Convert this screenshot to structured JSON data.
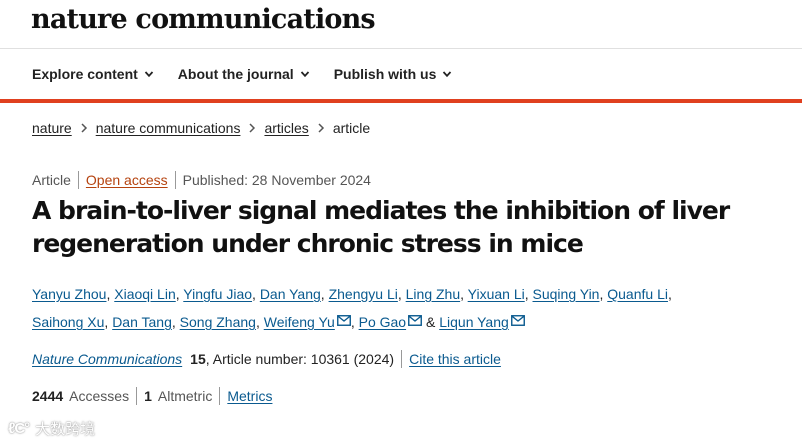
{
  "masthead": {
    "logo": "nature communications"
  },
  "nav": {
    "items": [
      {
        "label": "Explore content"
      },
      {
        "label": "About the journal"
      },
      {
        "label": "Publish with us"
      }
    ]
  },
  "breadcrumb": {
    "items": [
      "nature",
      "nature communications",
      "articles"
    ],
    "current": "article"
  },
  "meta": {
    "type": "Article",
    "access": "Open access",
    "published": "Published: 28 November 2024"
  },
  "article": {
    "title": "A brain-to-liver signal mediates the inhibition of liver regeneration under chronic stress in mice",
    "authors": [
      "Yanyu Zhou",
      "Xiaoqi Lin",
      "Yingfu Jiao",
      "Dan Yang",
      "Zhengyu Li",
      "Ling Zhu",
      "Yixuan Li",
      "Suqing Yin",
      "Quanfu Li",
      "Saihong Xu",
      "Dan Tang",
      "Song Zhang",
      "Weifeng Yu",
      "Po Gao",
      "Liqun Yang"
    ],
    "author_joiner": "&"
  },
  "citation": {
    "journal": "Nature Communications",
    "volume": "15",
    "article_number": ", Article number: 10361 (2024)",
    "cite_link": "Cite this article"
  },
  "metrics": {
    "accesses_value": "2444",
    "accesses_label": "Accesses",
    "altmetric_value": "1",
    "altmetric_label": "Altmetric",
    "metrics_link": "Metrics"
  },
  "watermark": {
    "logo": "ℓC°",
    "text": "大数跨境"
  },
  "colors": {
    "accent": "#e0401f",
    "link": "#0a5a8f",
    "open_access": "#b5420e"
  }
}
